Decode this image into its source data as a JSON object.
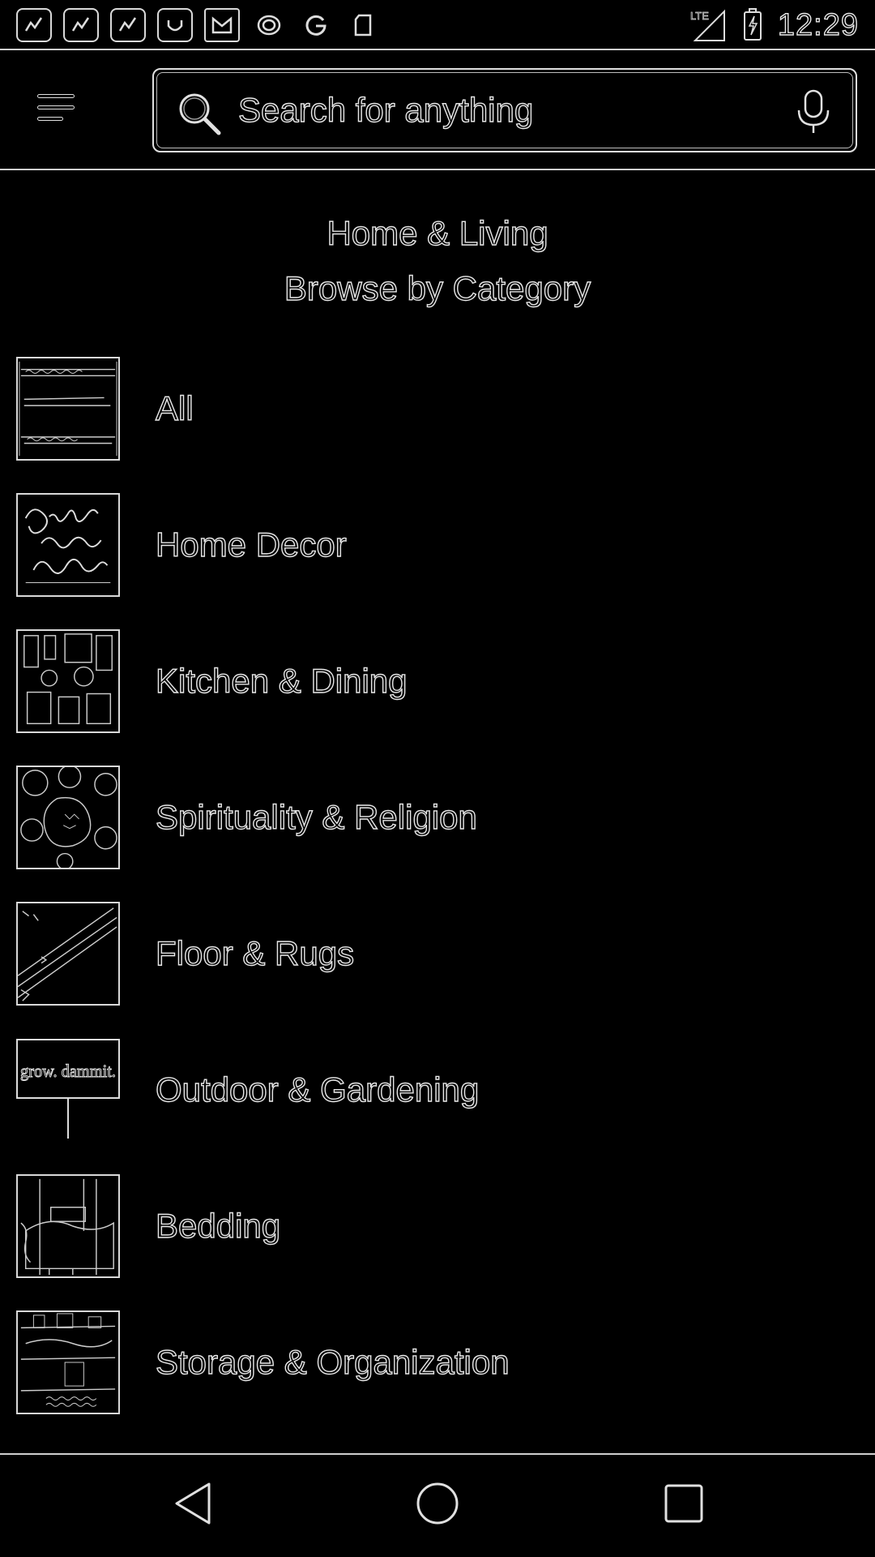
{
  "status_bar": {
    "notification_icons": [
      "chart-app-icon",
      "chart-app-icon",
      "chart-app-icon",
      "shopping-bag-icon",
      "gmail-icon",
      "ring-app-icon",
      "google-icon",
      "sd-card-icon"
    ],
    "network_label": "LTE",
    "time": "12:29"
  },
  "app_bar": {
    "search_placeholder": "Search for anything"
  },
  "page": {
    "title": "Home & Living",
    "subtitle": "Browse by Category"
  },
  "categories": [
    {
      "label": "All",
      "thumb_icon": "handwritten-sign-thumbnail"
    },
    {
      "label": "Home Decor",
      "thumb_icon": "drunk-in-love-script-thumbnail"
    },
    {
      "label": "Kitchen & Dining",
      "thumb_icon": "kitchen-items-thumbnail"
    },
    {
      "label": "Spirituality & Religion",
      "thumb_icon": "crystals-thumbnail"
    },
    {
      "label": "Floor & Rugs",
      "thumb_icon": "rug-thumbnail"
    },
    {
      "label": "Outdoor & Gardening",
      "thumb_icon": "garden-sign-thumbnail",
      "thumb_text": "grow. dammit."
    },
    {
      "label": "Bedding",
      "thumb_icon": "bedroom-thumbnail"
    },
    {
      "label": "Storage & Organization",
      "thumb_icon": "shelf-storage-thumbnail"
    }
  ],
  "nav_bar": {
    "buttons": [
      "back",
      "home",
      "recents"
    ]
  }
}
